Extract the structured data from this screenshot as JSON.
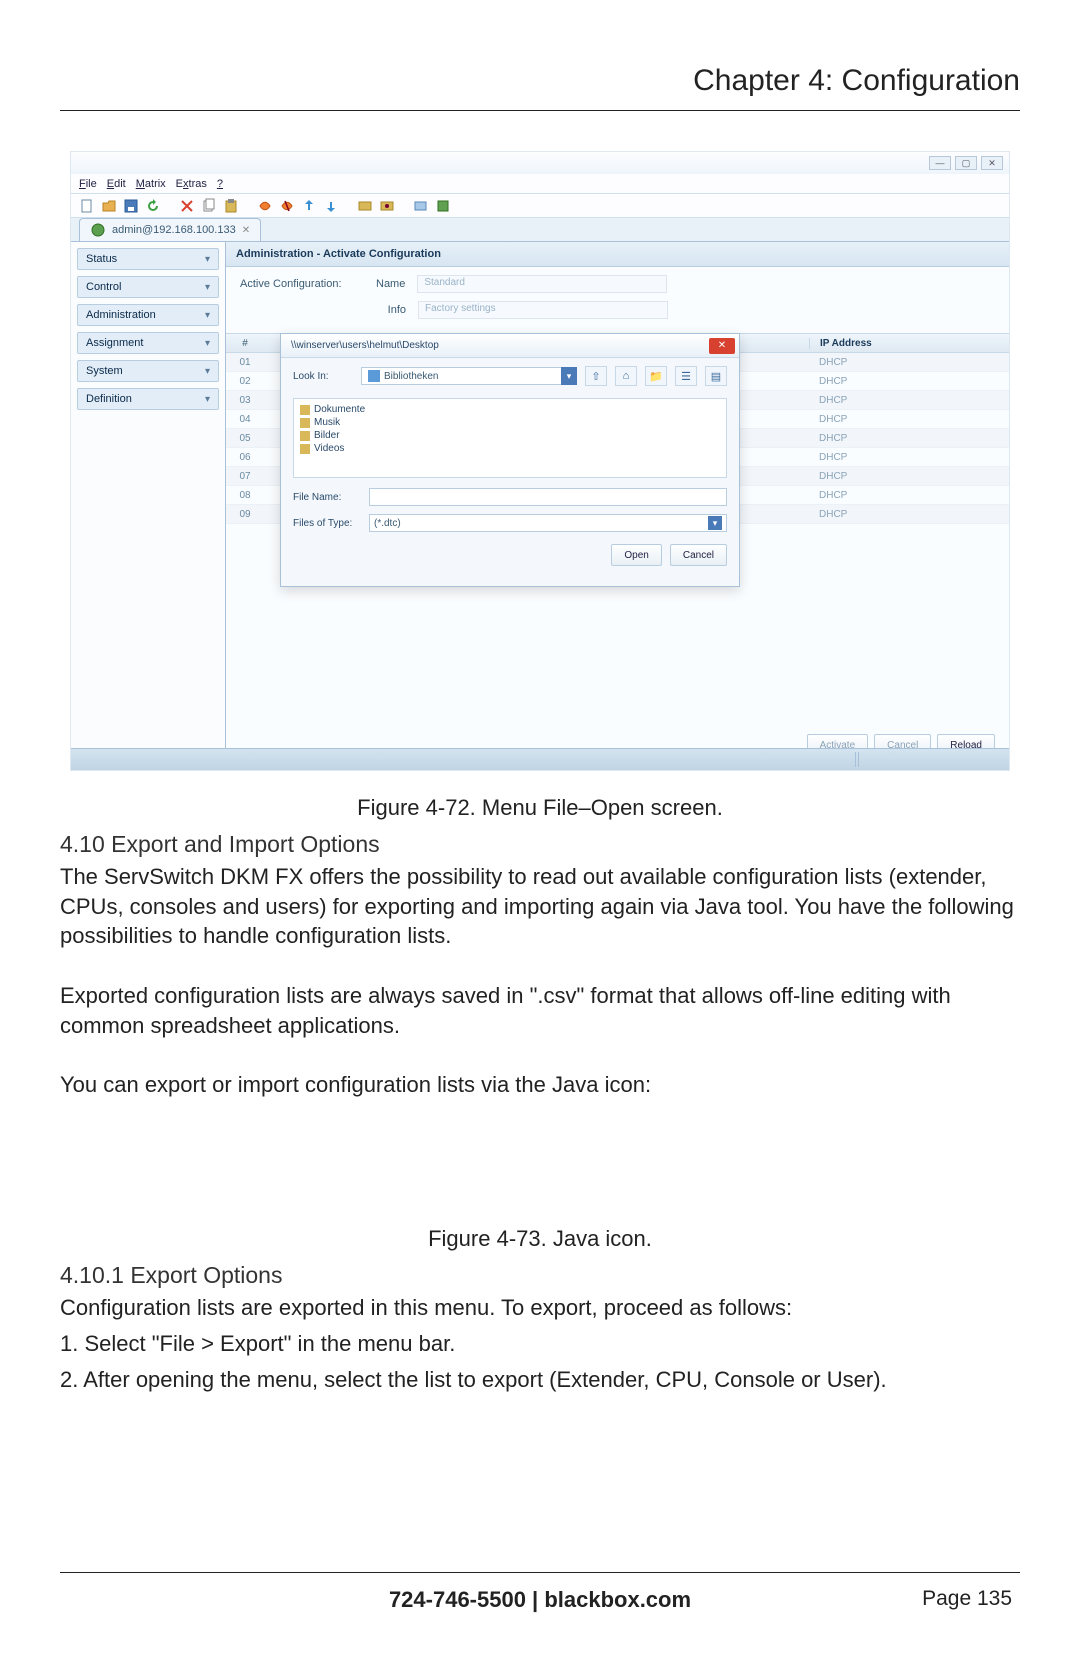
{
  "chapter": "Chapter 4: Configuration",
  "screenshot": {
    "menubar": {
      "items": [
        "File",
        "Edit",
        "Matrix",
        "Extras",
        "?"
      ]
    },
    "tab": {
      "label": "admin@192.168.100.133"
    },
    "sidebar": [
      "Status",
      "Control",
      "Administration",
      "Assignment",
      "System",
      "Definition"
    ],
    "panel_title": "Administration - Activate Configuration",
    "active_cfg_label": "Active Configuration:",
    "name_label": "Name",
    "name_value": "Standard",
    "info_label": "Info",
    "info_value": "Factory settings",
    "ip_col": "IP Address",
    "rows": [
      "01",
      "02",
      "03",
      "04",
      "05",
      "06",
      "07",
      "08",
      "09"
    ],
    "dhcp": "DHCP",
    "dialog": {
      "title": "\\\\winserver\\users\\helmut\\Desktop",
      "lookin_label": "Look In:",
      "lookin_value": "Bibliotheken",
      "items": [
        "Dokumente",
        "Musik",
        "Bilder",
        "Videos"
      ],
      "filename_label": "File Name:",
      "filetype_label": "Files of Type:",
      "filetype_value": "(*.dtc)",
      "open": "Open",
      "cancel": "Cancel"
    },
    "footer": {
      "activate": "Activate",
      "cancel": "Cancel",
      "reload": "Reload"
    }
  },
  "fig72": "Figure 4-72. Menu File–Open screen.",
  "s410": "4.10 Export and Import Options",
  "p1": "The ServSwitch DKM FX offers the possibility to read out available configuration lists (extender, CPUs, consoles and users) for exporting and importing again via Java tool. You have the following possibilities to handle configuration lists.",
  "p2": "Exported configuration lists are always saved in \".csv\" format that allows off-line editing with common spreadsheet applications.",
  "p3": "You can export or import configuration lists via the Java icon:",
  "fig73": "Figure 4-73. Java icon.",
  "s4101": "4.10.1 Export Options",
  "p4": "Configuration lists are exported in this menu. To export, proceed as follows:",
  "step1": "1. Select \"File > Export\" in the menu bar.",
  "step2": "2. After opening the menu, select the list to export (Extender, CPU, Console or User).",
  "footer_phone": "724-746-5500   |   blackbox.com",
  "footer_page": "Page 135"
}
